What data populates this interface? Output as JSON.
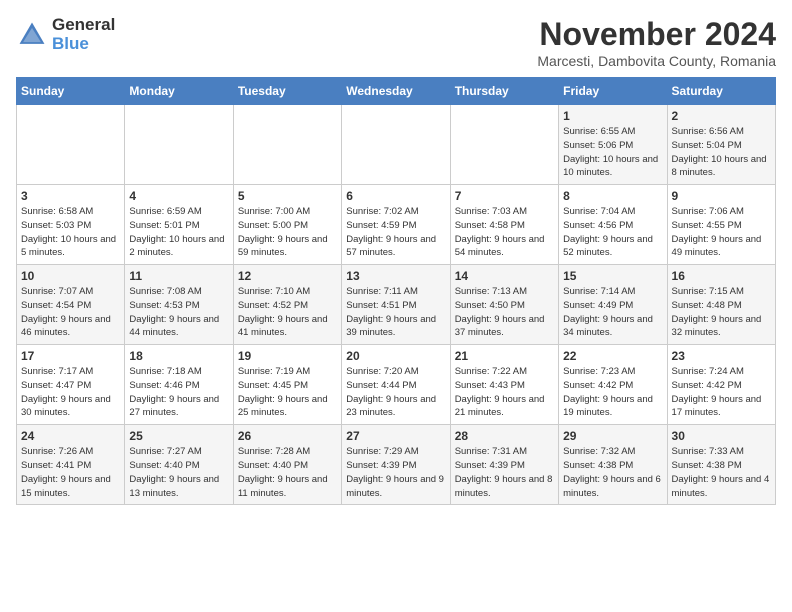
{
  "logo": {
    "general": "General",
    "blue": "Blue"
  },
  "title": "November 2024",
  "subtitle": "Marcesti, Dambovita County, Romania",
  "days_of_week": [
    "Sunday",
    "Monday",
    "Tuesday",
    "Wednesday",
    "Thursday",
    "Friday",
    "Saturday"
  ],
  "weeks": [
    [
      {
        "day": "",
        "info": ""
      },
      {
        "day": "",
        "info": ""
      },
      {
        "day": "",
        "info": ""
      },
      {
        "day": "",
        "info": ""
      },
      {
        "day": "",
        "info": ""
      },
      {
        "day": "1",
        "info": "Sunrise: 6:55 AM\nSunset: 5:06 PM\nDaylight: 10 hours and 10 minutes."
      },
      {
        "day": "2",
        "info": "Sunrise: 6:56 AM\nSunset: 5:04 PM\nDaylight: 10 hours and 8 minutes."
      }
    ],
    [
      {
        "day": "3",
        "info": "Sunrise: 6:58 AM\nSunset: 5:03 PM\nDaylight: 10 hours and 5 minutes."
      },
      {
        "day": "4",
        "info": "Sunrise: 6:59 AM\nSunset: 5:01 PM\nDaylight: 10 hours and 2 minutes."
      },
      {
        "day": "5",
        "info": "Sunrise: 7:00 AM\nSunset: 5:00 PM\nDaylight: 9 hours and 59 minutes."
      },
      {
        "day": "6",
        "info": "Sunrise: 7:02 AM\nSunset: 4:59 PM\nDaylight: 9 hours and 57 minutes."
      },
      {
        "day": "7",
        "info": "Sunrise: 7:03 AM\nSunset: 4:58 PM\nDaylight: 9 hours and 54 minutes."
      },
      {
        "day": "8",
        "info": "Sunrise: 7:04 AM\nSunset: 4:56 PM\nDaylight: 9 hours and 52 minutes."
      },
      {
        "day": "9",
        "info": "Sunrise: 7:06 AM\nSunset: 4:55 PM\nDaylight: 9 hours and 49 minutes."
      }
    ],
    [
      {
        "day": "10",
        "info": "Sunrise: 7:07 AM\nSunset: 4:54 PM\nDaylight: 9 hours and 46 minutes."
      },
      {
        "day": "11",
        "info": "Sunrise: 7:08 AM\nSunset: 4:53 PM\nDaylight: 9 hours and 44 minutes."
      },
      {
        "day": "12",
        "info": "Sunrise: 7:10 AM\nSunset: 4:52 PM\nDaylight: 9 hours and 41 minutes."
      },
      {
        "day": "13",
        "info": "Sunrise: 7:11 AM\nSunset: 4:51 PM\nDaylight: 9 hours and 39 minutes."
      },
      {
        "day": "14",
        "info": "Sunrise: 7:13 AM\nSunset: 4:50 PM\nDaylight: 9 hours and 37 minutes."
      },
      {
        "day": "15",
        "info": "Sunrise: 7:14 AM\nSunset: 4:49 PM\nDaylight: 9 hours and 34 minutes."
      },
      {
        "day": "16",
        "info": "Sunrise: 7:15 AM\nSunset: 4:48 PM\nDaylight: 9 hours and 32 minutes."
      }
    ],
    [
      {
        "day": "17",
        "info": "Sunrise: 7:17 AM\nSunset: 4:47 PM\nDaylight: 9 hours and 30 minutes."
      },
      {
        "day": "18",
        "info": "Sunrise: 7:18 AM\nSunset: 4:46 PM\nDaylight: 9 hours and 27 minutes."
      },
      {
        "day": "19",
        "info": "Sunrise: 7:19 AM\nSunset: 4:45 PM\nDaylight: 9 hours and 25 minutes."
      },
      {
        "day": "20",
        "info": "Sunrise: 7:20 AM\nSunset: 4:44 PM\nDaylight: 9 hours and 23 minutes."
      },
      {
        "day": "21",
        "info": "Sunrise: 7:22 AM\nSunset: 4:43 PM\nDaylight: 9 hours and 21 minutes."
      },
      {
        "day": "22",
        "info": "Sunrise: 7:23 AM\nSunset: 4:42 PM\nDaylight: 9 hours and 19 minutes."
      },
      {
        "day": "23",
        "info": "Sunrise: 7:24 AM\nSunset: 4:42 PM\nDaylight: 9 hours and 17 minutes."
      }
    ],
    [
      {
        "day": "24",
        "info": "Sunrise: 7:26 AM\nSunset: 4:41 PM\nDaylight: 9 hours and 15 minutes."
      },
      {
        "day": "25",
        "info": "Sunrise: 7:27 AM\nSunset: 4:40 PM\nDaylight: 9 hours and 13 minutes."
      },
      {
        "day": "26",
        "info": "Sunrise: 7:28 AM\nSunset: 4:40 PM\nDaylight: 9 hours and 11 minutes."
      },
      {
        "day": "27",
        "info": "Sunrise: 7:29 AM\nSunset: 4:39 PM\nDaylight: 9 hours and 9 minutes."
      },
      {
        "day": "28",
        "info": "Sunrise: 7:31 AM\nSunset: 4:39 PM\nDaylight: 9 hours and 8 minutes."
      },
      {
        "day": "29",
        "info": "Sunrise: 7:32 AM\nSunset: 4:38 PM\nDaylight: 9 hours and 6 minutes."
      },
      {
        "day": "30",
        "info": "Sunrise: 7:33 AM\nSunset: 4:38 PM\nDaylight: 9 hours and 4 minutes."
      }
    ]
  ]
}
